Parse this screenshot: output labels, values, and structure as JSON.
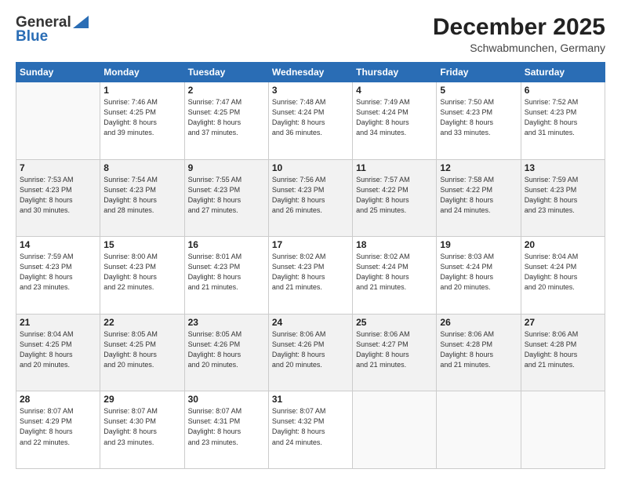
{
  "header": {
    "logo": {
      "line1": "General",
      "line2": "Blue"
    },
    "title": "December 2025",
    "location": "Schwabmunchen, Germany"
  },
  "days_header": [
    "Sunday",
    "Monday",
    "Tuesday",
    "Wednesday",
    "Thursday",
    "Friday",
    "Saturday"
  ],
  "weeks": [
    {
      "shaded": false,
      "days": [
        {
          "num": "",
          "info": ""
        },
        {
          "num": "1",
          "info": "Sunrise: 7:46 AM\nSunset: 4:25 PM\nDaylight: 8 hours\nand 39 minutes."
        },
        {
          "num": "2",
          "info": "Sunrise: 7:47 AM\nSunset: 4:25 PM\nDaylight: 8 hours\nand 37 minutes."
        },
        {
          "num": "3",
          "info": "Sunrise: 7:48 AM\nSunset: 4:24 PM\nDaylight: 8 hours\nand 36 minutes."
        },
        {
          "num": "4",
          "info": "Sunrise: 7:49 AM\nSunset: 4:24 PM\nDaylight: 8 hours\nand 34 minutes."
        },
        {
          "num": "5",
          "info": "Sunrise: 7:50 AM\nSunset: 4:23 PM\nDaylight: 8 hours\nand 33 minutes."
        },
        {
          "num": "6",
          "info": "Sunrise: 7:52 AM\nSunset: 4:23 PM\nDaylight: 8 hours\nand 31 minutes."
        }
      ]
    },
    {
      "shaded": true,
      "days": [
        {
          "num": "7",
          "info": "Sunrise: 7:53 AM\nSunset: 4:23 PM\nDaylight: 8 hours\nand 30 minutes."
        },
        {
          "num": "8",
          "info": "Sunrise: 7:54 AM\nSunset: 4:23 PM\nDaylight: 8 hours\nand 28 minutes."
        },
        {
          "num": "9",
          "info": "Sunrise: 7:55 AM\nSunset: 4:23 PM\nDaylight: 8 hours\nand 27 minutes."
        },
        {
          "num": "10",
          "info": "Sunrise: 7:56 AM\nSunset: 4:23 PM\nDaylight: 8 hours\nand 26 minutes."
        },
        {
          "num": "11",
          "info": "Sunrise: 7:57 AM\nSunset: 4:22 PM\nDaylight: 8 hours\nand 25 minutes."
        },
        {
          "num": "12",
          "info": "Sunrise: 7:58 AM\nSunset: 4:22 PM\nDaylight: 8 hours\nand 24 minutes."
        },
        {
          "num": "13",
          "info": "Sunrise: 7:59 AM\nSunset: 4:23 PM\nDaylight: 8 hours\nand 23 minutes."
        }
      ]
    },
    {
      "shaded": false,
      "days": [
        {
          "num": "14",
          "info": "Sunrise: 7:59 AM\nSunset: 4:23 PM\nDaylight: 8 hours\nand 23 minutes."
        },
        {
          "num": "15",
          "info": "Sunrise: 8:00 AM\nSunset: 4:23 PM\nDaylight: 8 hours\nand 22 minutes."
        },
        {
          "num": "16",
          "info": "Sunrise: 8:01 AM\nSunset: 4:23 PM\nDaylight: 8 hours\nand 21 minutes."
        },
        {
          "num": "17",
          "info": "Sunrise: 8:02 AM\nSunset: 4:23 PM\nDaylight: 8 hours\nand 21 minutes."
        },
        {
          "num": "18",
          "info": "Sunrise: 8:02 AM\nSunset: 4:24 PM\nDaylight: 8 hours\nand 21 minutes."
        },
        {
          "num": "19",
          "info": "Sunrise: 8:03 AM\nSunset: 4:24 PM\nDaylight: 8 hours\nand 20 minutes."
        },
        {
          "num": "20",
          "info": "Sunrise: 8:04 AM\nSunset: 4:24 PM\nDaylight: 8 hours\nand 20 minutes."
        }
      ]
    },
    {
      "shaded": true,
      "days": [
        {
          "num": "21",
          "info": "Sunrise: 8:04 AM\nSunset: 4:25 PM\nDaylight: 8 hours\nand 20 minutes."
        },
        {
          "num": "22",
          "info": "Sunrise: 8:05 AM\nSunset: 4:25 PM\nDaylight: 8 hours\nand 20 minutes."
        },
        {
          "num": "23",
          "info": "Sunrise: 8:05 AM\nSunset: 4:26 PM\nDaylight: 8 hours\nand 20 minutes."
        },
        {
          "num": "24",
          "info": "Sunrise: 8:06 AM\nSunset: 4:26 PM\nDaylight: 8 hours\nand 20 minutes."
        },
        {
          "num": "25",
          "info": "Sunrise: 8:06 AM\nSunset: 4:27 PM\nDaylight: 8 hours\nand 21 minutes."
        },
        {
          "num": "26",
          "info": "Sunrise: 8:06 AM\nSunset: 4:28 PM\nDaylight: 8 hours\nand 21 minutes."
        },
        {
          "num": "27",
          "info": "Sunrise: 8:06 AM\nSunset: 4:28 PM\nDaylight: 8 hours\nand 21 minutes."
        }
      ]
    },
    {
      "shaded": false,
      "days": [
        {
          "num": "28",
          "info": "Sunrise: 8:07 AM\nSunset: 4:29 PM\nDaylight: 8 hours\nand 22 minutes."
        },
        {
          "num": "29",
          "info": "Sunrise: 8:07 AM\nSunset: 4:30 PM\nDaylight: 8 hours\nand 23 minutes."
        },
        {
          "num": "30",
          "info": "Sunrise: 8:07 AM\nSunset: 4:31 PM\nDaylight: 8 hours\nand 23 minutes."
        },
        {
          "num": "31",
          "info": "Sunrise: 8:07 AM\nSunset: 4:32 PM\nDaylight: 8 hours\nand 24 minutes."
        },
        {
          "num": "",
          "info": ""
        },
        {
          "num": "",
          "info": ""
        },
        {
          "num": "",
          "info": ""
        }
      ]
    }
  ]
}
